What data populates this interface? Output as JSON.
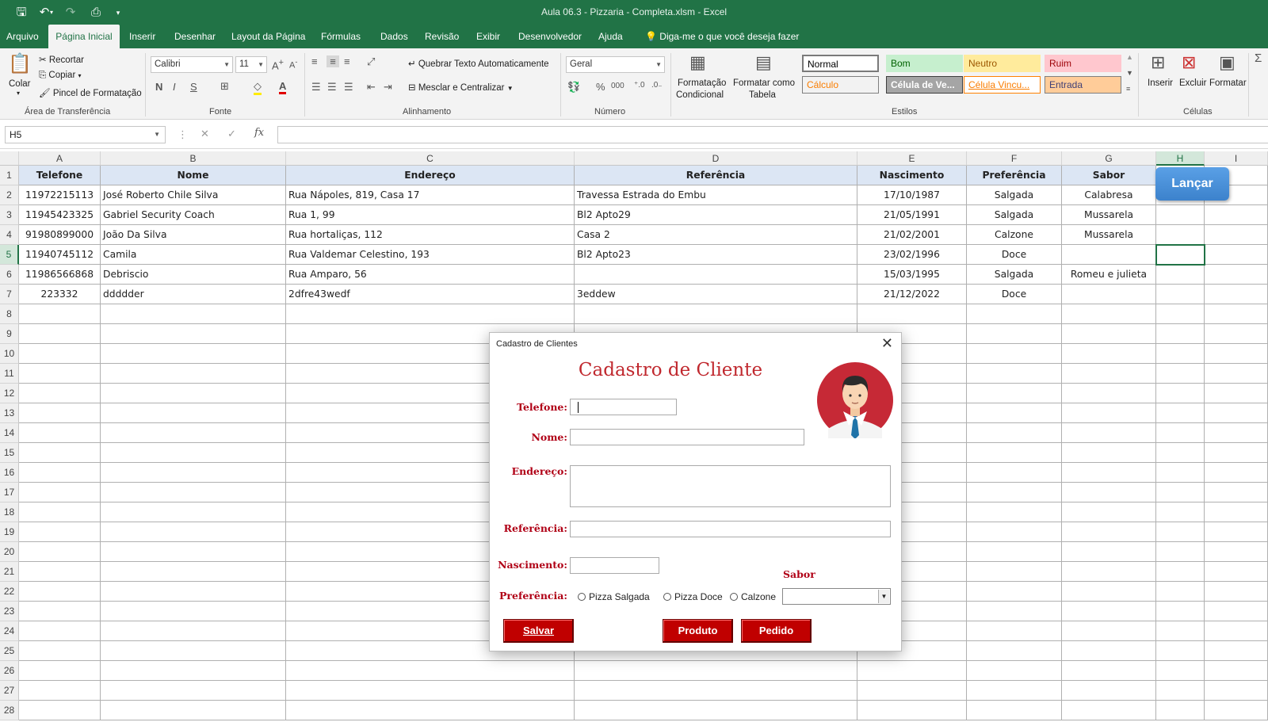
{
  "window": {
    "title": "Aula 06.3 - Pizzaria - Completa.xlsm  -  Excel"
  },
  "menu": {
    "tabs": [
      "Arquivo",
      "Página Inicial",
      "Inserir",
      "Desenhar",
      "Layout da Página",
      "Fórmulas",
      "Dados",
      "Revisão",
      "Exibir",
      "Desenvolvedor",
      "Ajuda"
    ],
    "tell_me": "Diga-me o que você deseja fazer",
    "active_tab": "Página Inicial"
  },
  "ribbon": {
    "clipboard": {
      "paste": "Colar",
      "cut": "Recortar",
      "copy": "Copiar",
      "format_painter": "Pincel de Formatação",
      "group": "Área de Transferência"
    },
    "font": {
      "name": "Calibri",
      "size": "11",
      "bold": "N",
      "italic": "I",
      "underline": "S",
      "group": "Fonte"
    },
    "alignment": {
      "wrap": "Quebrar Texto Automaticamente",
      "merge": "Mesclar e Centralizar",
      "group": "Alinhamento"
    },
    "number": {
      "format": "Geral",
      "percent": "%",
      "thousands": "000",
      "group": "Número"
    },
    "styles": {
      "cond_format_1": "Formatação",
      "cond_format_2": "Condicional",
      "format_table_1": "Formatar como",
      "format_table_2": "Tabela",
      "group": "Estilos",
      "cells": [
        {
          "label": "Normal",
          "bg": "#ffffff",
          "fg": "#000000",
          "border": "#7a7a7a"
        },
        {
          "label": "Bom",
          "bg": "#c6efce",
          "fg": "#006100",
          "border": "#c6efce"
        },
        {
          "label": "Neutro",
          "bg": "#ffeb9c",
          "fg": "#9c5700",
          "border": "#ffeb9c"
        },
        {
          "label": "Ruim",
          "bg": "#ffc7ce",
          "fg": "#9c0006",
          "border": "#ffc7ce"
        },
        {
          "label": "Cálculo",
          "bg": "#f2f2f2",
          "fg": "#fa7d00",
          "border": "#7f7f7f"
        },
        {
          "label": "Célula de Ve...",
          "bg": "#a5a5a5",
          "fg": "#ffffff",
          "border": "#3f3f3f"
        },
        {
          "label": "Célula Vincu...",
          "bg": "#ffffff",
          "fg": "#fa7d00",
          "border": "#ff8001"
        },
        {
          "label": "Entrada",
          "bg": "#ffcc99",
          "fg": "#3f3f76",
          "border": "#7f7f7f"
        }
      ]
    },
    "cells_group": {
      "insert": "Inserir",
      "delete": "Excluir",
      "format": "Formatar",
      "group": "Células"
    }
  },
  "formula_bar": {
    "name_box": "H5",
    "fx": "fx",
    "content": ""
  },
  "sheet": {
    "columns": [
      "A",
      "B",
      "C",
      "D",
      "E",
      "F",
      "G",
      "H",
      "I"
    ],
    "selected_column": "H",
    "selected_row": 5,
    "headers": [
      "Telefone",
      "Nome",
      "Endereço",
      "Referência",
      "Nascimento",
      "Preferência",
      "Sabor"
    ],
    "rows": [
      [
        "11972215113",
        "José Roberto Chile Silva",
        "Rua Nápoles, 819, Casa 17",
        "Travessa Estrada do Embu",
        "17/10/1987",
        "Salgada",
        "Calabresa"
      ],
      [
        "11945423325",
        "Gabriel Security Coach",
        "Rua 1, 99",
        "Bl2 Apto29",
        "21/05/1991",
        "Salgada",
        "Mussarela"
      ],
      [
        "91980899000",
        "João Da Silva",
        "Rua hortaliças, 112",
        "Casa 2",
        "21/02/2001",
        "Calzone",
        "Mussarela"
      ],
      [
        "11940745112",
        "Camila",
        "Rua Valdemar Celestino, 193",
        "Bl2 Apto23",
        "23/02/1996",
        "Doce",
        ""
      ],
      [
        "11986566868",
        "Debriscio",
        "Rua Amparo, 56",
        "",
        "15/03/1995",
        "Salgada",
        "Romeu e julieta"
      ],
      [
        "223332",
        "ddddder",
        "2dfre43wedf",
        "3eddew",
        "21/12/2022",
        "Doce",
        ""
      ]
    ],
    "row_numbers": [
      1,
      2,
      3,
      4,
      5,
      6,
      7,
      8,
      9,
      10,
      11,
      12,
      13,
      14,
      15,
      16,
      17,
      18,
      19,
      20,
      21,
      22,
      23,
      24,
      25,
      26,
      27,
      28
    ]
  },
  "lancar_button": "Lançar",
  "dialog": {
    "window_title": "Cadastro de Clientes",
    "heading": "Cadastro de Cliente",
    "labels": {
      "telefone": "Telefone:",
      "nome": "Nome:",
      "endereco": "Endereço:",
      "referencia": "Referência:",
      "nascimento": "Nascimento:",
      "preferencia": "Preferência:",
      "sabor": "Sabor"
    },
    "values": {
      "telefone": "",
      "nome": "",
      "endereco": "",
      "referencia": "",
      "nascimento": "",
      "sabor": ""
    },
    "options": [
      "Pizza Salgada",
      "Pizza Doce",
      "Calzone"
    ],
    "buttons": {
      "salvar": "Salvar",
      "produto": "Produto",
      "pedido": "Pedido"
    }
  }
}
